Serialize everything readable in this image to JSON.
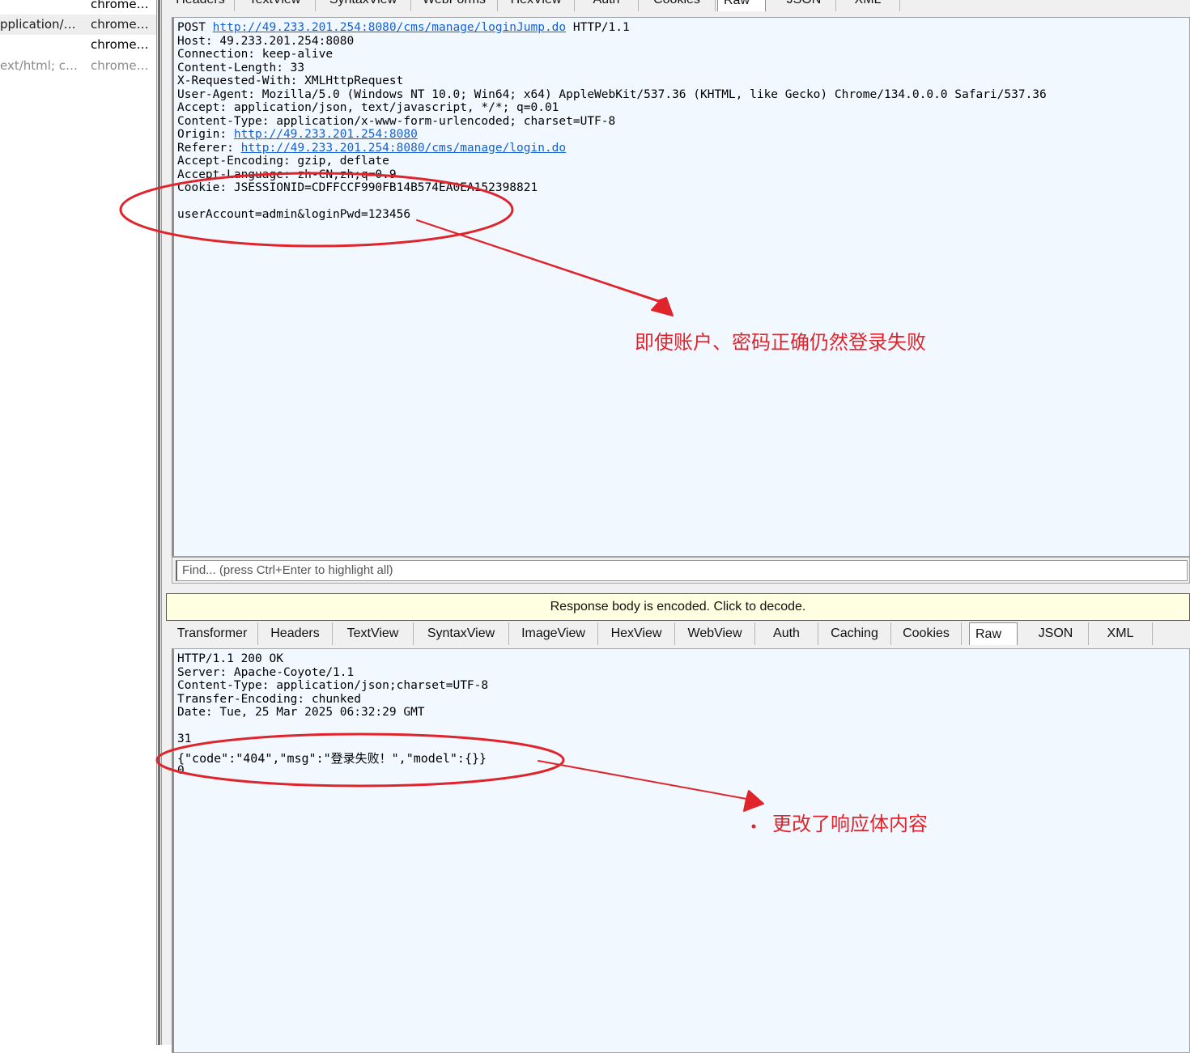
{
  "sessions": [
    {
      "ctype": "",
      "process": "chrome…"
    },
    {
      "ctype": "pplication/…",
      "process": "chrome…"
    },
    {
      "ctype": "",
      "process": "chrome…"
    },
    {
      "ctype": "ext/html; c…",
      "process": "chrome…"
    }
  ],
  "request_tabs": [
    "Headers",
    "TextView",
    "SyntaxView",
    "WebForms",
    "HexView",
    "Auth",
    "Cookies",
    "Raw",
    "JSON",
    "XML"
  ],
  "request": {
    "method": "POST",
    "url": "http://49.233.201.254:8080/cms/manage/loginJump.do",
    "protocol": "HTTP/1.1",
    "host_line": "Host: 49.233.201.254:8080",
    "connection_line": "Connection: keep-alive",
    "content_length_line": "Content-Length: 33",
    "x_requested_line": "X-Requested-With: XMLHttpRequest",
    "user_agent_line": "User-Agent: Mozilla/5.0 (Windows NT 10.0; Win64; x64) AppleWebKit/537.36 (KHTML, like Gecko) Chrome/134.0.0.0 Safari/537.36",
    "accept_line": "Accept: application/json, text/javascript, */*; q=0.01",
    "content_type_line": "Content-Type: application/x-www-form-urlencoded; charset=UTF-8",
    "origin_label": "Origin: ",
    "origin_url": "http://49.233.201.254:8080",
    "referer_label": "Referer: ",
    "referer_url": "http://49.233.201.254:8080/cms/manage/login.do",
    "accept_encoding_line": "Accept-Encoding: gzip, deflate",
    "accept_language_line": "Accept-Language: zh-CN,zh;q=0.9",
    "cookie_line": "Cookie: JSESSIONID=CDFFCCF990FB14B574EA0EA152398821",
    "body": "userAccount=admin&loginPwd=123456"
  },
  "find_placeholder": "Find... (press Ctrl+Enter to highlight all)",
  "encoded_notice": "Response body is encoded. Click to decode.",
  "response_tabs": [
    "Transformer",
    "Headers",
    "TextView",
    "SyntaxView",
    "ImageView",
    "HexView",
    "WebView",
    "Auth",
    "Caching",
    "Cookies",
    "Raw",
    "JSON",
    "XML"
  ],
  "response": {
    "status_line": "HTTP/1.1 200 OK",
    "server_line": "Server: Apache-Coyote/1.1",
    "content_type_line": "Content-Type: application/json;charset=UTF-8",
    "transfer_encoding_line": "Transfer-Encoding: chunked",
    "date_line": "Date: Tue, 25 Mar 2025 06:32:29 GMT",
    "chunk_size": "31",
    "body": "{\"code\":\"404\",\"msg\":\"登录失败！\",\"model\":{}}",
    "chunk_end": "0"
  },
  "annotations": {
    "request_note": "即使账户、密码正确仍然登录失败",
    "response_note": "更改了响应体内容",
    "color": "#e0242b"
  }
}
